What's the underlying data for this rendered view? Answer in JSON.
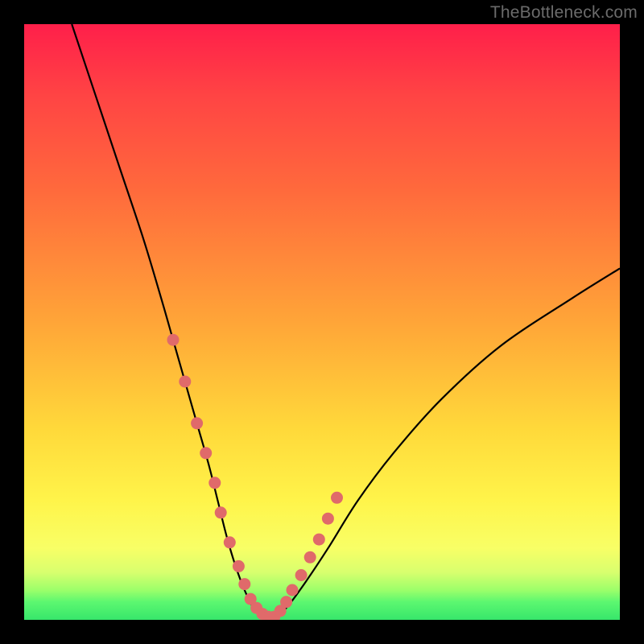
{
  "watermark": "TheBottleneck.com",
  "chart_data": {
    "type": "line",
    "title": "",
    "xlabel": "",
    "ylabel": "",
    "xlim": [
      0,
      100
    ],
    "ylim": [
      0,
      100
    ],
    "series": [
      {
        "name": "bottleneck-curve",
        "x": [
          8,
          12,
          16,
          20,
          23,
          25,
          27,
          29,
          31,
          32.5,
          34,
          35.5,
          37,
          38.5,
          40,
          42,
          44,
          47,
          51,
          56,
          62,
          70,
          80,
          92,
          100
        ],
        "y": [
          100,
          88,
          76,
          64,
          54,
          47,
          40,
          33,
          26,
          20,
          14,
          9,
          5,
          2,
          0.5,
          0.5,
          2,
          6,
          12,
          20,
          28,
          37,
          46,
          54,
          59
        ]
      }
    ],
    "markers": {
      "name": "highlight-dots",
      "color": "#e06a6a",
      "x": [
        25,
        27,
        29,
        30.5,
        32,
        33,
        34.5,
        36,
        37,
        38,
        39,
        40,
        41,
        42,
        43,
        44,
        45,
        46.5,
        48,
        49.5,
        51,
        52.5
      ],
      "y": [
        47,
        40,
        33,
        28,
        23,
        18,
        13,
        9,
        6,
        3.5,
        2,
        1,
        0.5,
        0.5,
        1.5,
        3,
        5,
        7.5,
        10.5,
        13.5,
        17,
        20.5
      ]
    }
  }
}
